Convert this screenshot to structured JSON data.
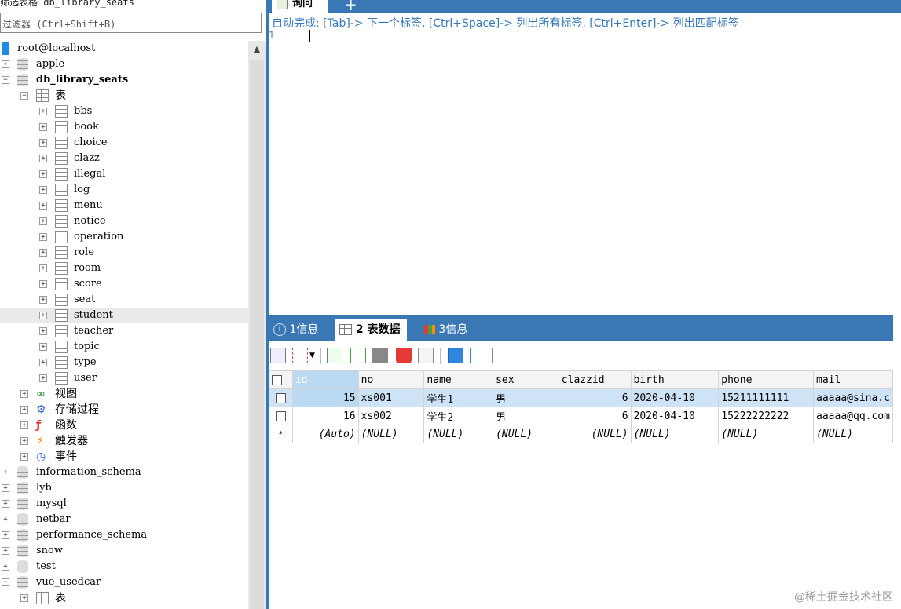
{
  "left": {
    "title": "筛选表格 db_library_seats",
    "filter_placeholder": "过滤器 (Ctrl+Shift+B)",
    "tree": [
      {
        "level": 0,
        "type": "root",
        "label": "root@localhost",
        "expander": ""
      },
      {
        "level": 0,
        "type": "db",
        "label": "apple",
        "expander": "+"
      },
      {
        "level": 0,
        "type": "db",
        "label": "db_library_seats",
        "expander": "-",
        "bold": true
      },
      {
        "level": 1,
        "type": "folder",
        "label": "表",
        "expander": "-"
      },
      {
        "level": 2,
        "type": "table",
        "label": "bbs",
        "expander": "+"
      },
      {
        "level": 2,
        "type": "table",
        "label": "book",
        "expander": "+"
      },
      {
        "level": 2,
        "type": "table",
        "label": "choice",
        "expander": "+"
      },
      {
        "level": 2,
        "type": "table",
        "label": "clazz",
        "expander": "+"
      },
      {
        "level": 2,
        "type": "table",
        "label": "illegal",
        "expander": "+"
      },
      {
        "level": 2,
        "type": "table",
        "label": "log",
        "expander": "+"
      },
      {
        "level": 2,
        "type": "table",
        "label": "menu",
        "expander": "+"
      },
      {
        "level": 2,
        "type": "table",
        "label": "notice",
        "expander": "+"
      },
      {
        "level": 2,
        "type": "table",
        "label": "operation",
        "expander": "+"
      },
      {
        "level": 2,
        "type": "table",
        "label": "role",
        "expander": "+"
      },
      {
        "level": 2,
        "type": "table",
        "label": "room",
        "expander": "+"
      },
      {
        "level": 2,
        "type": "table",
        "label": "score",
        "expander": "+"
      },
      {
        "level": 2,
        "type": "table",
        "label": "seat",
        "expander": "+"
      },
      {
        "level": 2,
        "type": "table",
        "label": "student",
        "expander": "+",
        "selected": true
      },
      {
        "level": 2,
        "type": "table",
        "label": "teacher",
        "expander": "+"
      },
      {
        "level": 2,
        "type": "table",
        "label": "topic",
        "expander": "+"
      },
      {
        "level": 2,
        "type": "table",
        "label": "type",
        "expander": "+"
      },
      {
        "level": 2,
        "type": "table",
        "label": "user",
        "expander": "+"
      },
      {
        "level": 1,
        "type": "views",
        "label": "视图",
        "expander": "+"
      },
      {
        "level": 1,
        "type": "procs",
        "label": "存储过程",
        "expander": "+"
      },
      {
        "level": 1,
        "type": "funcs",
        "label": "函数",
        "expander": "+"
      },
      {
        "level": 1,
        "type": "triggers",
        "label": "触发器",
        "expander": "+"
      },
      {
        "level": 1,
        "type": "events",
        "label": "事件",
        "expander": "+"
      },
      {
        "level": 0,
        "type": "db",
        "label": "information_schema",
        "expander": "+"
      },
      {
        "level": 0,
        "type": "db",
        "label": "lyb",
        "expander": "+"
      },
      {
        "level": 0,
        "type": "db",
        "label": "mysql",
        "expander": "+"
      },
      {
        "level": 0,
        "type": "db",
        "label": "netbar",
        "expander": "+"
      },
      {
        "level": 0,
        "type": "db",
        "label": "performance_schema",
        "expander": "+"
      },
      {
        "level": 0,
        "type": "db",
        "label": "snow",
        "expander": "+"
      },
      {
        "level": 0,
        "type": "db",
        "label": "test",
        "expander": "+"
      },
      {
        "level": 0,
        "type": "db",
        "label": "vue_usedcar",
        "expander": "-"
      },
      {
        "level": 1,
        "type": "folder",
        "label": "表",
        "expander": "+"
      }
    ]
  },
  "editor": {
    "tab_label": "询问",
    "hint": "自动完成: [Tab]-> 下一个标签, [Ctrl+Space]-> 列出所有标签, [Ctrl+Enter]-> 列出匹配标签",
    "line_number": "1"
  },
  "results": {
    "tabs": [
      {
        "num": "1",
        "label": "信息",
        "icon": "info-icon",
        "active": false
      },
      {
        "num": "2",
        "label": "表数据",
        "icon": "table-icon",
        "active": true
      },
      {
        "num": "3",
        "label": "信息",
        "icon": "chart-icon",
        "active": false
      }
    ],
    "columns": [
      "id",
      "no",
      "name",
      "sex",
      "clazzid",
      "birth",
      "phone",
      "mail"
    ],
    "rows": [
      {
        "id": "15",
        "no": "xs001",
        "name": "学生1",
        "sex": "男",
        "clazzid": "6",
        "birth": "2020-04-10",
        "phone": "15211111111",
        "mail": "aaaaa@sina.c"
      },
      {
        "id": "16",
        "no": "xs002",
        "name": "学生2",
        "sex": "男",
        "clazzid": "6",
        "birth": "2020-04-10",
        "phone": "15222222222",
        "mail": "aaaaa@qq.com"
      }
    ],
    "new_row": {
      "marker": "*",
      "id": "(Auto)",
      "no": "(NULL)",
      "name": "(NULL)",
      "sex": "(NULL)",
      "clazzid": "(NULL)",
      "birth": "(NULL)",
      "phone": "(NULL)",
      "mail": "(NULL)"
    }
  },
  "watermark": "@稀土掘金技术社区",
  "colors": {
    "accent": "#3a78b5",
    "hint": "#3578b8",
    "selection": "#cfe3f7"
  }
}
